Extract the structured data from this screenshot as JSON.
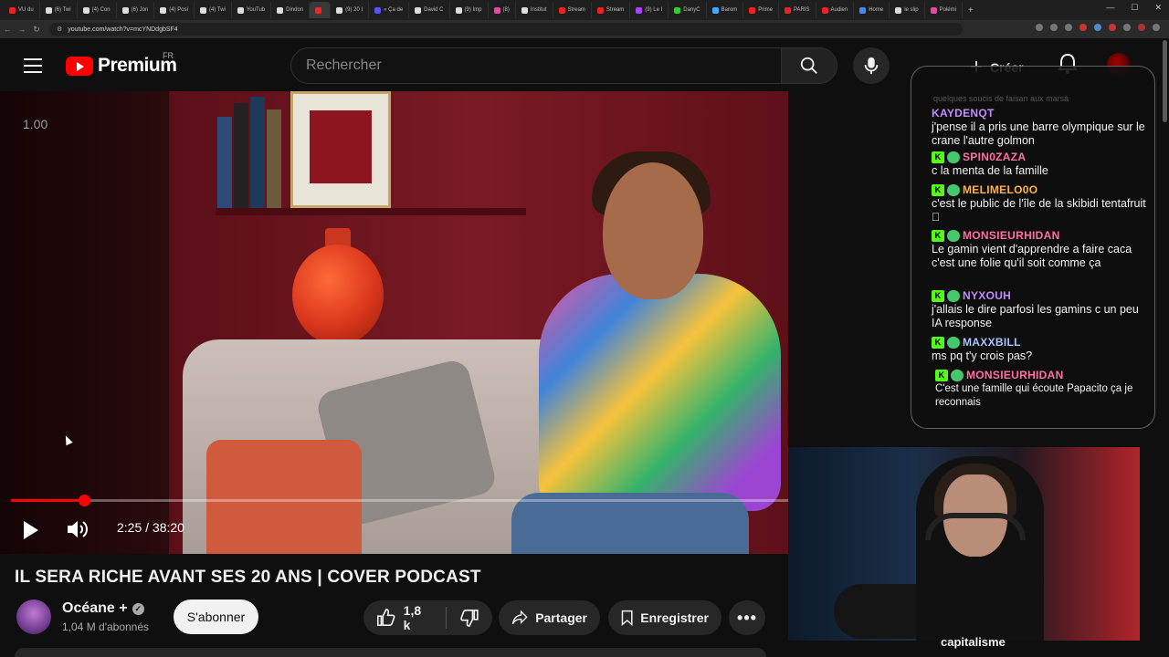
{
  "browser": {
    "tabs": [
      {
        "label": "VU du",
        "color": "#e22"
      },
      {
        "label": "(6) Twi",
        "color": "#ddd"
      },
      {
        "label": "(4) Con",
        "color": "#ddd"
      },
      {
        "label": "(6) Jon",
        "color": "#ddd"
      },
      {
        "label": "(4) Posi",
        "color": "#ddd"
      },
      {
        "label": "(4) Twi",
        "color": "#ddd"
      },
      {
        "label": "YouTub",
        "color": "#ddd"
      },
      {
        "label": "Dindon",
        "color": "#ddd"
      },
      {
        "label": "",
        "color": "#f22"
      },
      {
        "label": "(9) 20 I",
        "color": "#ddd"
      },
      {
        "label": "« Ça de",
        "color": "#55f"
      },
      {
        "label": "David C",
        "color": "#ddd"
      },
      {
        "label": "(9) Imp",
        "color": "#ddd"
      },
      {
        "label": "(8)",
        "color": "#e4a"
      },
      {
        "label": "Institut",
        "color": "#ddd"
      },
      {
        "label": "Stream",
        "color": "#e22"
      },
      {
        "label": "Stream",
        "color": "#e22"
      },
      {
        "label": "(9) Le I",
        "color": "#a4f"
      },
      {
        "label": "DanyC",
        "color": "#3c3"
      },
      {
        "label": "Barom",
        "color": "#4af"
      },
      {
        "label": "Prime",
        "color": "#e22"
      },
      {
        "label": "PARIS",
        "color": "#e22"
      },
      {
        "label": "Audien",
        "color": "#e22"
      },
      {
        "label": "Home",
        "color": "#48f"
      },
      {
        "label": "le slip",
        "color": "#ddd"
      },
      {
        "label": "Polémi",
        "color": "#e4a"
      }
    ],
    "url": "youtube.com/watch?v=mcYNDdgbSF4"
  },
  "masthead": {
    "brand": "Premium",
    "country": "FR",
    "search_placeholder": "Rechercher",
    "create_label": "Créer"
  },
  "player": {
    "speed_overlay": "1.00",
    "time": "2:25 / 38:20",
    "progress": 0.094
  },
  "video": {
    "title": "IL SERA RICHE AVANT SES 20 ANS | COVER PODCAST",
    "channel": "Océane +",
    "subscribers": "1,04 M d'abonnés",
    "subscribe_label": "S'abonner",
    "likes": "1,8 k",
    "share_label": "Partager",
    "save_label": "Enregistrer"
  },
  "chat": {
    "top_fragment": "quelques soucis de faisan aux marsa",
    "messages": [
      {
        "user": "KAYDENQT",
        "color": "#c08cff",
        "badges": false,
        "text": "j'pense il a pris une barre olympique sur le crane l'autre golmon"
      },
      {
        "user": "SPIN0ZAZA",
        "color": "#ff6fa6",
        "badges": true,
        "text": "c la menta de la famille"
      },
      {
        "user": "MELIMELO0O",
        "color": "#ffb347",
        "badges": true,
        "text": "c'est le public de l'île de la skibidi tentafruit \u0000"
      },
      {
        "user": "MONSIEURHIDAN",
        "color": "#ff6fa6",
        "badges": true,
        "text": "Le gamin vient d'apprendre a faire caca c'est une folie qu'il soit comme ça"
      },
      {
        "user": "NYXOUH",
        "color": "#c08cff",
        "badges": true,
        "text": "j'allais le dire parfosi les gamins c un peu IA response"
      },
      {
        "user": "MAXXBILL",
        "color": "#a9c3ff",
        "badges": true,
        "text": "ms pq t'y crois pas?"
      },
      {
        "user": "MONSIEURHIDAN",
        "color": "#ff6fa6",
        "badges": true,
        "text": "C'est une famille qui écoute Papacito ça je reconnais"
      }
    ]
  },
  "cam": {
    "caption": "capitalisme"
  }
}
